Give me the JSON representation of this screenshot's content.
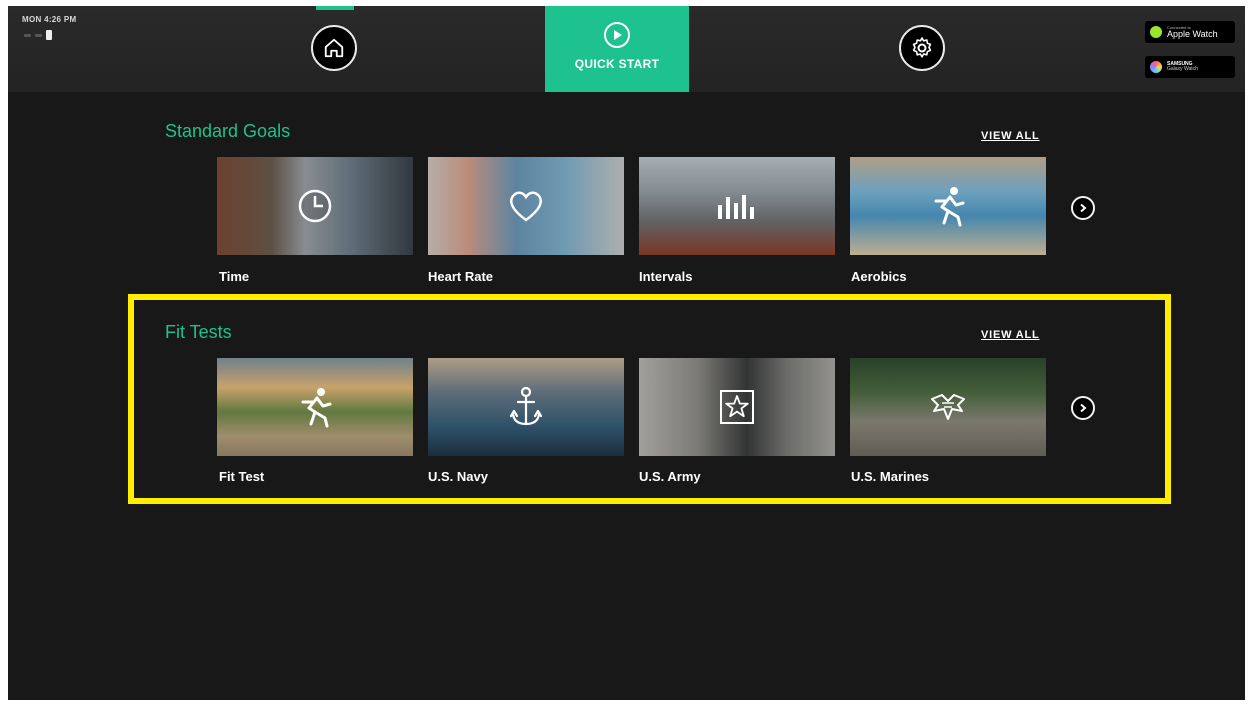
{
  "status_bar": {
    "clock": "MON 4:26 PM"
  },
  "nav": {
    "quick_start_label": "QUICK START"
  },
  "watches": {
    "apple": {
      "small": "Connected to",
      "name": "Apple Watch"
    },
    "samsung": {
      "small": "SAMSUNG",
      "name": "Galaxy Watch"
    }
  },
  "standard_goals": {
    "title": "Standard Goals",
    "view_all": "VIEW ALL",
    "cards": [
      {
        "label": "Time",
        "icon": "clock-icon"
      },
      {
        "label": "Heart Rate",
        "icon": "heart-icon"
      },
      {
        "label": "Intervals",
        "icon": "bars-icon"
      },
      {
        "label": "Aerobics",
        "icon": "runner-icon"
      }
    ]
  },
  "fit_tests": {
    "title": "Fit Tests",
    "view_all": "VIEW ALL",
    "cards": [
      {
        "label": "Fit Test",
        "icon": "runner-icon"
      },
      {
        "label": "U.S. Navy",
        "icon": "anchor-icon"
      },
      {
        "label": "U.S. Army",
        "icon": "star-badge-icon"
      },
      {
        "label": "U.S. Marines",
        "icon": "eagle-emblem-icon"
      }
    ]
  },
  "colors": {
    "accent": "#1dc28e",
    "highlight": "#ffee00",
    "background": "#181818"
  }
}
